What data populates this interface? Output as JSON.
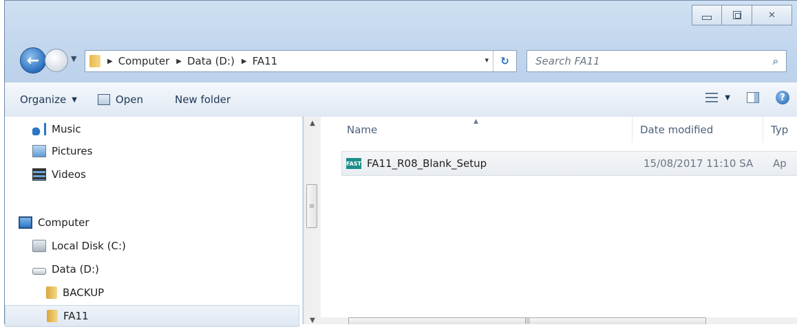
{
  "window": {
    "minimize": "",
    "maximize": "",
    "close": ""
  },
  "address_bar": {
    "crumbs": [
      "Computer",
      "Data (D:)",
      "FA11"
    ],
    "dropdown_glyph": "▾",
    "refresh_glyph": "↻"
  },
  "search": {
    "placeholder": "Search FA11"
  },
  "toolbar": {
    "organize_label": "Organize",
    "open_label": "Open",
    "new_folder_label": "New folder"
  },
  "nav_pane": {
    "items": [
      {
        "label": "Music",
        "icon": "music-icon"
      },
      {
        "label": "Pictures",
        "icon": "pictures-icon"
      },
      {
        "label": "Videos",
        "icon": "videos-icon"
      },
      {
        "label": "Computer",
        "icon": "computer-icon"
      },
      {
        "label": "Local Disk (C:)",
        "icon": "local-disk-icon"
      },
      {
        "label": "Data (D:)",
        "icon": "drive-icon"
      },
      {
        "label": "BACKUP",
        "icon": "folder-icon"
      },
      {
        "label": "FA11",
        "icon": "folder-icon",
        "selected": true
      }
    ]
  },
  "columns": {
    "name": "Name",
    "date_modified": "Date modified",
    "type": "Typ"
  },
  "files": [
    {
      "icon_text": "FAST",
      "name": "FA11_R08_Blank_Setup",
      "date_modified": "15/08/2017 11:10 SA",
      "type": "Ap"
    }
  ],
  "colors": {
    "accent": "#2a6fbf",
    "frame": "#c3d7ee"
  }
}
